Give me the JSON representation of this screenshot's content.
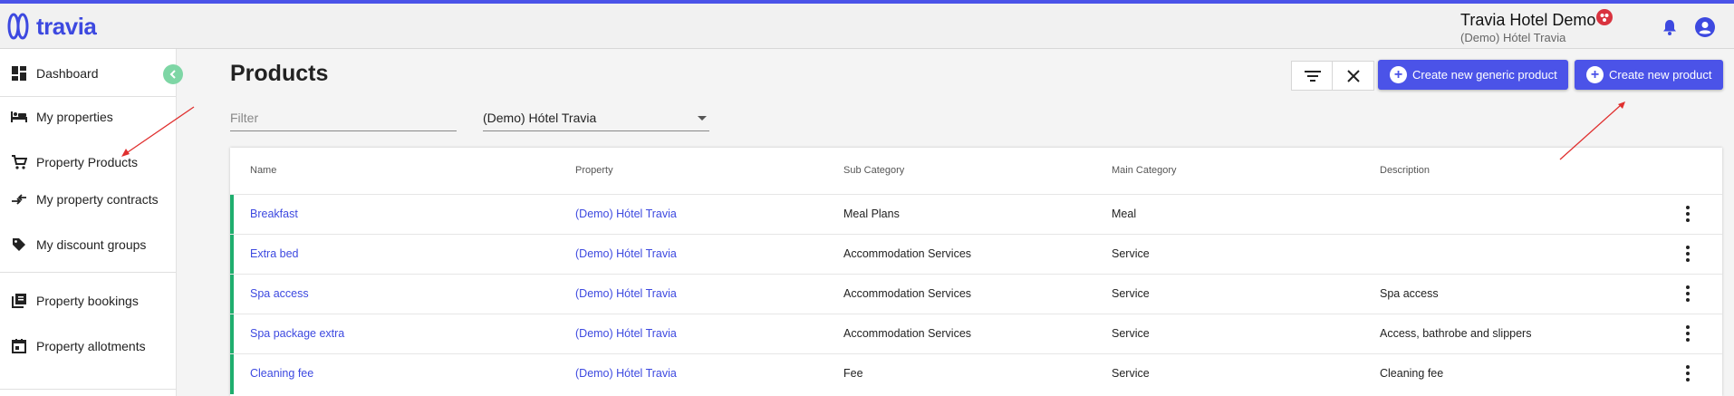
{
  "app": {
    "logo_text": "travia"
  },
  "header": {
    "hotel_name": "Travia Hotel Demo",
    "hotel_sub": "(Demo) Hótel Travia"
  },
  "sidebar": {
    "items": [
      {
        "label": "Dashboard",
        "icon": "dashboard-icon"
      },
      {
        "label": "My properties",
        "icon": "bed-icon"
      },
      {
        "label": "Property Products",
        "icon": "cart-icon"
      },
      {
        "label": "My property contracts",
        "icon": "swap-icon"
      },
      {
        "label": "My discount groups",
        "icon": "tag-icon"
      },
      {
        "label": "Property bookings",
        "icon": "library-icon"
      },
      {
        "label": "Property allotments",
        "icon": "calendar-icon"
      }
    ]
  },
  "main": {
    "title": "Products",
    "filter_placeholder": "Filter",
    "property_select": "(Demo) Hótel Travia",
    "create_generic_label": "Create new generic product",
    "create_product_label": "Create new product"
  },
  "table": {
    "columns": [
      "Name",
      "Property",
      "Sub Category",
      "Main Category",
      "Description"
    ],
    "rows": [
      {
        "name": "Breakfast",
        "property": "(Demo) Hótel Travia",
        "sub": "Meal Plans",
        "main": "Meal",
        "desc": ""
      },
      {
        "name": "Extra bed",
        "property": "(Demo) Hótel Travia",
        "sub": "Accommodation Services",
        "main": "Service",
        "desc": ""
      },
      {
        "name": "Spa access",
        "property": "(Demo) Hótel Travia",
        "sub": "Accommodation Services",
        "main": "Service",
        "desc": "Spa access"
      },
      {
        "name": "Spa package extra",
        "property": "(Demo) Hótel Travia",
        "sub": "Accommodation Services",
        "main": "Service",
        "desc": "Access, bathrobe and slippers"
      },
      {
        "name": "Cleaning fee",
        "property": "(Demo) Hótel Travia",
        "sub": "Fee",
        "main": "Service",
        "desc": "Cleaning fee"
      }
    ]
  },
  "colors": {
    "brand": "#4b53e8",
    "row_accent": "#1fae6e",
    "annotation": "#e0302f"
  }
}
